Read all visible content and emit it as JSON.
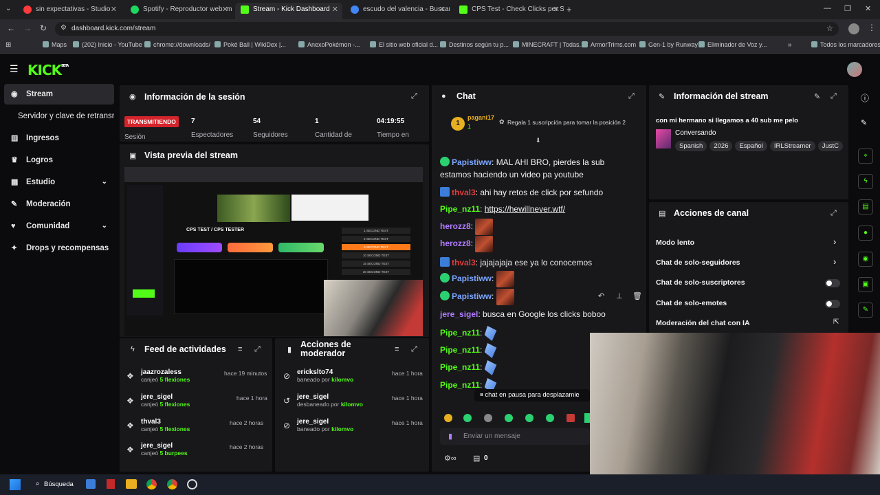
{
  "browser": {
    "tabs": [
      {
        "label": "sin expectativas - Studio",
        "color": "#ff3b3b"
      },
      {
        "label": "Spotify - Reproductor web: mú",
        "color": "#1ed760"
      },
      {
        "label": "Stream - Kick Dashboard",
        "color": "#53fc18"
      },
      {
        "label": "escudo del valencia - Buscar co",
        "color": "#4285f4"
      },
      {
        "label": "CPS Test - Check Clicks per Sec",
        "color": "#53fc18"
      }
    ],
    "url": "dashboard.kick.com/stream",
    "bookmarks": [
      "Maps",
      "(202) Inicio - YouTube",
      "chrome://downloads/",
      "Poké Ball | WikiDex |...",
      "AnexoPokémon -...",
      "El sitio web oficial d...",
      "Destinos según tu p...",
      "MINECRAFT | Todas...",
      "ArmorTrims.com",
      "Gen-1 by Runway",
      "Eliminador de Voz y...",
      "Todos los marcadores"
    ]
  },
  "kick": {
    "logo": "KICK",
    "logo_sup": "BETA"
  },
  "sidebar": {
    "items": [
      {
        "label": "Stream",
        "icon": "stream-icon"
      },
      {
        "label": "Servidor y clave de retransm",
        "icon": ""
      },
      {
        "label": "Ingresos",
        "icon": "revenue-icon"
      },
      {
        "label": "Logros",
        "icon": "trophy-icon"
      },
      {
        "label": "Estudio",
        "icon": "studio-icon"
      },
      {
        "label": "Moderación",
        "icon": "wrench-icon"
      },
      {
        "label": "Comunidad",
        "icon": "community-icon"
      },
      {
        "label": "Drops y recompensas",
        "icon": "gift-icon"
      }
    ]
  },
  "session": {
    "title": "Información de la sesión",
    "live_badge": "TRANSMITIENDO",
    "session_label": "Sesión",
    "stats": [
      {
        "value": "7",
        "label": "Espectadores"
      },
      {
        "value": "54",
        "label": "Seguidores"
      },
      {
        "value": "1",
        "label": "Cantidad de"
      },
      {
        "value": "04:19:55",
        "label": "Tiempo en"
      }
    ]
  },
  "preview": {
    "title": "Vista previa del stream",
    "inner_title": "CPS TEST / CPS TESTER",
    "inner_tests": [
      "1 SECOND TEST",
      "2 SECOND TEST",
      "5 SECOND TEST",
      "10 SECOND TEST",
      "15 SECOND TEST",
      "30 SECOND TEST"
    ]
  },
  "activity": {
    "title": "Feed de actividades",
    "items": [
      {
        "user": "jaazrozaless",
        "action": "canjeó",
        "reward": "5 flexiones",
        "time": "hace 19 minutos"
      },
      {
        "user": "jere_sigel",
        "action": "canjeó",
        "reward": "5 flexiones",
        "time": "hace 1 hora"
      },
      {
        "user": "thval3",
        "action": "canjeó",
        "reward": "5 flexiones",
        "time": "hace 2 horas"
      },
      {
        "user": "jere_sigel",
        "action": "canjeó",
        "reward": "5 burpees",
        "time": "hace 2 horas"
      }
    ]
  },
  "mod_actions": {
    "title": "Acciones de moderador",
    "items": [
      {
        "user": "erickslto74",
        "action": "baneado por",
        "by": "kilomvo",
        "time": "hace 1 hora"
      },
      {
        "user": "jere_sigel",
        "action": "desbaneado por",
        "by": "kilomvo",
        "time": "hace 1 hora"
      },
      {
        "user": "jere_sigel",
        "action": "baneado por",
        "by": "kilomvo",
        "time": "hace 1 hora"
      }
    ]
  },
  "chat": {
    "title": "Chat",
    "pinned_user": "pagani17",
    "pinned_rank": "1",
    "pinned_count": "1",
    "pinned_text": "Regala 1 suscripción para tomar la posición 2",
    "messages": [
      {
        "user": "Papistiww",
        "color": "#7aa5ff",
        "text": "MAL AHI BRO, pierdes la sub",
        "text2": "estamos haciendo un video pa youtube"
      },
      {
        "user": "thval3",
        "color": "#e03c3c",
        "text": "ahi hay retos de click por sefundo"
      },
      {
        "user": "Pipe_nz11",
        "color": "#53fc18",
        "text": "https://hewillnever.wtf/"
      },
      {
        "user": "herozz8",
        "color": "#b07cff",
        "text": ""
      },
      {
        "user": "herozz8",
        "color": "#b07cff",
        "text": ""
      },
      {
        "user": "thval3",
        "color": "#e03c3c",
        "text": "jajajajaja ese ya lo conocemos"
      },
      {
        "user": "Papistiww",
        "color": "#7aa5ff",
        "text": ""
      },
      {
        "user": "Papistiww",
        "color": "#7aa5ff",
        "text": ""
      },
      {
        "user": "jere_sigel",
        "color": "#b07cff",
        "text": "busca en Google los clicks boboo"
      },
      {
        "user": "Pipe_nz11",
        "color": "#53fc18",
        "text": ""
      },
      {
        "user": "Pipe_nz11",
        "color": "#53fc18",
        "text": ""
      },
      {
        "user": "Pipe_nz11",
        "color": "#53fc18",
        "text": ""
      },
      {
        "user": "Pipe_nz11",
        "color": "#53fc18",
        "text": ""
      }
    ],
    "paused_text": "chat en pausa para desplazamie",
    "input_placeholder": "Enviar un mensaje",
    "viewer_count": "0"
  },
  "stream_info": {
    "title": "Información del stream",
    "stream_title": "con mi hermano si llegamos a 40 sub me pelo",
    "category": "Conversando",
    "tags": [
      "Spanish",
      "2026",
      "Español",
      "IRLStreamer",
      "JustC"
    ]
  },
  "channel_actions": {
    "title": "Acciones de canal",
    "items": [
      {
        "label": "Modo lento",
        "control": "arrow"
      },
      {
        "label": "Chat de solo-seguidores",
        "control": "arrow"
      },
      {
        "label": "Chat de solo-suscriptores",
        "control": "toggle"
      },
      {
        "label": "Chat de solo-emotes",
        "control": "toggle"
      },
      {
        "label": "Moderación del chat con IA",
        "control": "link"
      }
    ]
  },
  "taskbar": {
    "search": "Búsqueda"
  },
  "colors": {
    "kick_green": "#53fc18",
    "live_red": "#d4242b",
    "panel_bg": "#18181b"
  }
}
